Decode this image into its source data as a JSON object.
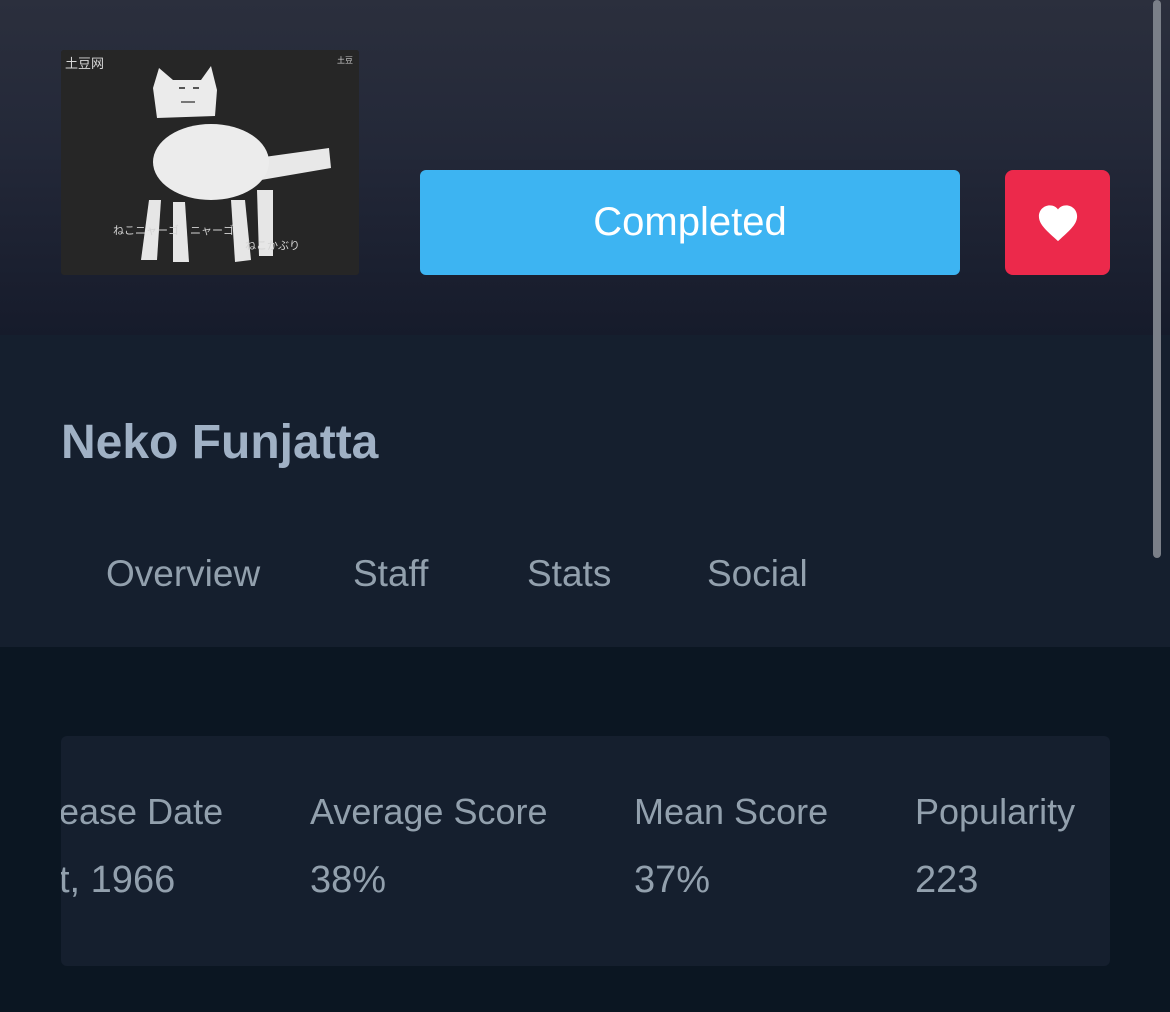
{
  "media": {
    "title": "Neko Funjatta",
    "cover": {
      "watermark_left": "土豆网",
      "watermark_right": "土豆",
      "subtitle_line1": "ねこニャーゴ　ニャーゴ",
      "subtitle_line2": "ねこかぶり"
    }
  },
  "actions": {
    "status_label": "Completed",
    "favorite_icon": "heart-icon"
  },
  "tabs": [
    "Overview",
    "Staff",
    "Stats",
    "Social"
  ],
  "stats": [
    {
      "label": "ease Date",
      "value": "t, 1966"
    },
    {
      "label": "Average Score",
      "value": "38%"
    },
    {
      "label": "Mean Score",
      "value": "37%"
    },
    {
      "label": "Popularity",
      "value": "223"
    }
  ],
  "colors": {
    "accent": "#3db4f2",
    "favorite": "#ec294b",
    "page_bg": "#0b1622",
    "panel_bg": "#151f2e"
  }
}
